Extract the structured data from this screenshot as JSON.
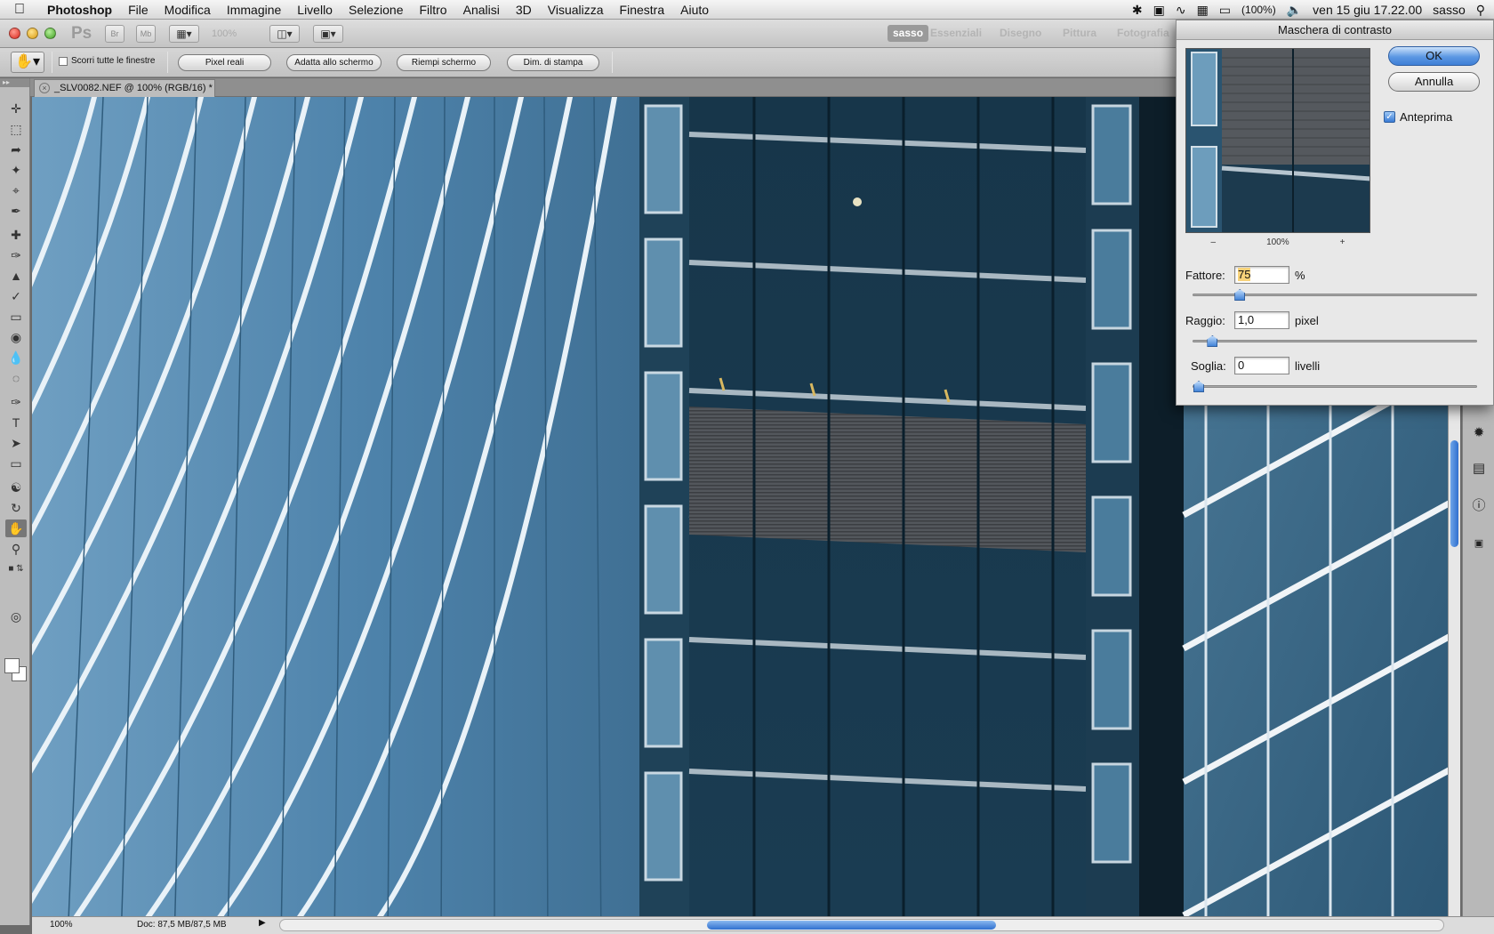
{
  "menubar": {
    "app_name": "Photoshop",
    "items": [
      "File",
      "Modifica",
      "Immagine",
      "Livello",
      "Selezione",
      "Filtro",
      "Analisi",
      "3D",
      "Visualizza",
      "Finestra",
      "Aiuto"
    ],
    "battery": "(100%)",
    "clock": "ven 15 giu  17.22.00",
    "user": "sasso"
  },
  "appbar": {
    "logo": "Ps",
    "btn_br": "Br",
    "btn_mb": "Mb",
    "zoom": "100%",
    "workspaces": [
      "sasso",
      "Essenziali",
      "Disegno",
      "Pittura",
      "Fotografia"
    ],
    "active_workspace": "sasso"
  },
  "options": {
    "scroll_all_label": "Scorri tutte le finestre",
    "buttons": [
      "Pixel reali",
      "Adatta allo schermo",
      "Riempi schermo",
      "Dim. di stampa"
    ]
  },
  "document": {
    "tab_title": "_SLV0082.NEF @ 100% (RGB/16) *"
  },
  "status": {
    "zoom": "100%",
    "doc_info": "Doc: 87,5 MB/87,5 MB"
  },
  "dialog": {
    "title": "Maschera di contrasto",
    "ok": "OK",
    "cancel": "Annulla",
    "preview_label": "Anteprima",
    "preview_checked": true,
    "preview_zoom": "100%",
    "zoom_out": "–",
    "zoom_in": "+",
    "amount_label": "Fattore:",
    "amount_value": "75",
    "amount_unit": "%",
    "amount_fraction": 0.15,
    "radius_label": "Raggio:",
    "radius_value": "1,0",
    "radius_unit": "pixel",
    "radius_fraction": 0.05,
    "threshold_label": "Soglia:",
    "threshold_value": "0",
    "threshold_unit": "livelli",
    "threshold_fraction": 0.0
  },
  "colors": {
    "accent": "#3e7fd6",
    "facade_left": "#5c8fb4",
    "facade_dark": "#123044"
  }
}
